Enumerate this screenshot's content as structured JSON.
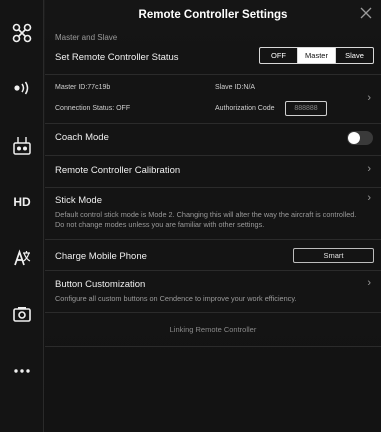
{
  "header": {
    "title": "Remote Controller Settings"
  },
  "sidebar": {
    "items": [
      {
        "name": "aircraft-icon"
      },
      {
        "name": "signal-icon"
      },
      {
        "name": "remote-controller-icon"
      },
      {
        "label": "HD",
        "name": "hd-label"
      },
      {
        "name": "general-settings-icon"
      },
      {
        "name": "camera-icon"
      },
      {
        "name": "more-icon"
      }
    ]
  },
  "master_slave": {
    "section_label": "Master and Slave",
    "status_label": "Set Remote Controller Status",
    "options": [
      "OFF",
      "Master",
      "Slave"
    ],
    "selected": "Master",
    "master_id": "Master ID:77c19b",
    "slave_id": "Slave ID:N/A",
    "connection_status": "Connection Status: OFF",
    "auth_label": "Authorization Code",
    "auth_code": "888888"
  },
  "coach_mode": {
    "label": "Coach Mode",
    "enabled": false
  },
  "calibration": {
    "label": "Remote Controller Calibration"
  },
  "stick_mode": {
    "label": "Stick Mode",
    "description": "Default control stick mode is Mode 2. Changing this will alter the way the aircraft is controlled. Do not change modes unless you are familiar with other settings."
  },
  "charge": {
    "label": "Charge Mobile Phone",
    "value": "Smart"
  },
  "button_custom": {
    "label": "Button Customization",
    "description": "Configure all custom buttons on Cendence to improve your work efficiency."
  },
  "linking": {
    "label": "Linking Remote Controller"
  },
  "colors": {
    "background": "#141414",
    "text": "#e8e8e8",
    "muted": "#9a9a9a",
    "active_segment": "#ffffff"
  }
}
